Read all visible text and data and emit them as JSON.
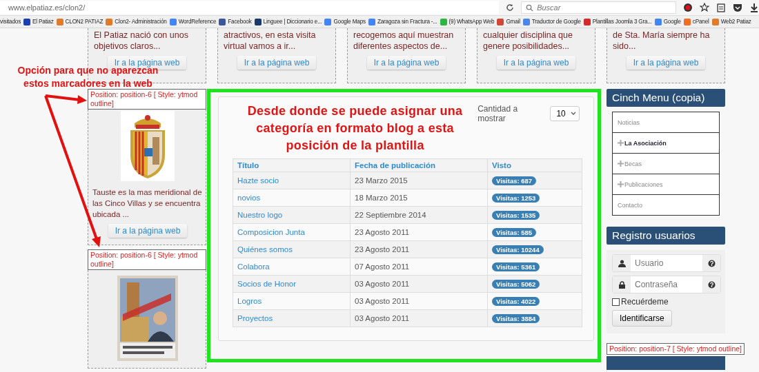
{
  "browser": {
    "url": "www.elpatiaz.es/clon2/",
    "search": {
      "placeholder": "Buscar"
    },
    "bookmarks": [
      {
        "label": "visitados"
      },
      {
        "label": "El Patiaz",
        "color": "#1a3fb0"
      },
      {
        "label": "CLON2 PATIAZ",
        "color": "#e07b2a"
      },
      {
        "label": "Clon2- Administración",
        "color": "#e07b2a"
      },
      {
        "label": "WordReference",
        "color": "#4285f4"
      },
      {
        "label": "Facebook",
        "color": "#3b5998"
      },
      {
        "label": "Linguee | Diccionario e...",
        "color": "#1b3a6b"
      },
      {
        "label": "Google Maps",
        "color": "#4285f4"
      },
      {
        "label": "Zaragoza sin Fractura -...",
        "color": "#4285f4"
      },
      {
        "label": "(9) WhatsApp Web",
        "color": "#2bb741"
      },
      {
        "label": "Gmail",
        "color": "#d44638"
      },
      {
        "label": "Traductor de Google",
        "color": "#4a86e8"
      },
      {
        "label": "Plantillas Joomla 3 Gra...",
        "color": "#d42a2a"
      },
      {
        "label": "Google",
        "color": "#4285f4"
      },
      {
        "label": "cPanel",
        "color": "#f26c22"
      },
      {
        "label": "Web2 Patiaz",
        "color": "#e07b2a"
      }
    ]
  },
  "top_cards": [
    {
      "text": "El Patiaz nació con unos objetivos claros...",
      "button": "Ir a la página web"
    },
    {
      "text": "atractivos, en esta visita virtual vamos a ir...",
      "button": "Ir a la página web"
    },
    {
      "text": "recogemos aquí muestran diferentes aspectos de...",
      "button": "Ir a la página web"
    },
    {
      "text": "cualquier disciplina que genere posibilidades...",
      "button": "Ir a la página web"
    },
    {
      "text": "de Sta. María siempre ha sido...",
      "button": "Ir a la página web"
    }
  ],
  "left_annotation": "Opción para que no aparezcan estos marcadores en la web",
  "left_column": [
    {
      "position_label": "Position: position-6 [ Style: ytmod outline]",
      "text": "Tauste es la mas meridional de las Cinco Villas y se encuentra ubicada ...",
      "button": "Ir a la página web"
    },
    {
      "position_label": "Position: position-6 [ Style: ytmod outline]"
    }
  ],
  "center": {
    "annotation": "Desde donde se puede asignar una categoría en formato blog a esta posición de la plantilla",
    "limit": {
      "label": "Cantidad a mostrar",
      "value": "10"
    },
    "table": {
      "columns": [
        "Título",
        "Fecha de publicación",
        "Visto"
      ],
      "rows": [
        {
          "title": "Hazte socio",
          "date": "23 Marzo 2015",
          "views": "Visitas: 687"
        },
        {
          "title": "novios",
          "date": "18 Marzo 2015",
          "views": "Visitas: 1253"
        },
        {
          "title": "Nuestro logo",
          "date": "22 Septiembre 2014",
          "views": "Visitas: 1535"
        },
        {
          "title": "Composicion Junta",
          "date": "23 Agosto 2011",
          "views": "Visitas: 585"
        },
        {
          "title": "Quiénes somos",
          "date": "23 Agosto 2011",
          "views": "Visitas: 10244"
        },
        {
          "title": "Colabora",
          "date": "07 Agosto 2011",
          "views": "Visitas: 5361"
        },
        {
          "title": "Socios de Honor",
          "date": "03 Agosto 2011",
          "views": "Visitas: 5062"
        },
        {
          "title": "Logros",
          "date": "03 Agosto 2011",
          "views": "Visitas: 4022"
        },
        {
          "title": "Proyectos",
          "date": "03 Agosto 2011",
          "views": "Visitas: 3884"
        }
      ]
    }
  },
  "right_column": {
    "menu": {
      "title": "Cinch Menu (copia)",
      "items": [
        {
          "label": "Noticias",
          "has_children": false,
          "selected": false
        },
        {
          "label": "La Asociación",
          "has_children": true,
          "selected": true
        },
        {
          "label": "Becas",
          "has_children": true,
          "selected": false
        },
        {
          "label": "Publicaciones",
          "has_children": true,
          "selected": false
        },
        {
          "label": "Contacto",
          "has_children": false,
          "selected": false
        }
      ]
    },
    "login": {
      "title": "Registro usuarios",
      "username": {
        "placeholder": "Usuario"
      },
      "password": {
        "placeholder": "Contraseña"
      },
      "remember": {
        "label": "Recuérdeme",
        "checked": false
      },
      "button": "Identificarse"
    },
    "position_label": "Position: position-7 [ Style: ytmod outline]"
  }
}
